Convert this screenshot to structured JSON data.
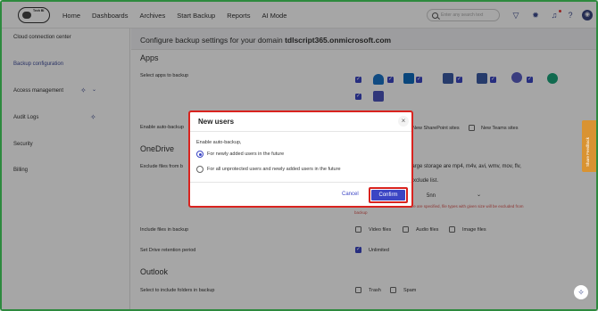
{
  "nav": {
    "brand": "Tech BI",
    "items": [
      "Home",
      "Dashboards",
      "Archives",
      "Start Backup",
      "Reports",
      "AI Mode"
    ],
    "search_placeholder": "Enter any search text"
  },
  "sidebar": {
    "items": [
      "Cloud connection center",
      "Backup configuration",
      "Access management",
      "Audit Logs",
      "Security",
      "Billing"
    ]
  },
  "main": {
    "banner_prefix": "Configure backup settings for your domain ",
    "banner_domain": "tdlscript365.onmicrosoft.com",
    "apps_title": "Apps",
    "select_apps_label": "Select apps to backup",
    "enable_auto_label": "Enable auto-backup",
    "sharepoint_opt": "New SharePoint sites",
    "teams_opt": "New Teams sites",
    "onedrive_title": "OneDrive",
    "exclude_label": "Exclude files from b",
    "exclude_text": "Large storage are mp4, m4v, avi, wmv, mov, flv,",
    "exclude_text2": "xclude list.",
    "size_value": "5nn",
    "size_hint": "ize are specified, file types with given size will be excluded from",
    "size_hint2": "backup",
    "include_files_label": "Include files in backup",
    "include_opts": [
      "Video files",
      "Audio files",
      "Image files"
    ],
    "retention_label": "Set Drive retention period",
    "retention_value": "Unlimited",
    "outlook_title": "Outlook",
    "outlook_label": "Select to include folders in backup",
    "outlook_opts": [
      "Trash",
      "Spam"
    ]
  },
  "modal": {
    "title": "New users",
    "close": "×",
    "subtitle": "Enable auto-backup,",
    "option1": "For newly added users in the future",
    "option2": "For all unprotected users and newly added users in the future",
    "cancel": "Cancel",
    "confirm": "Confirm"
  },
  "feedback": "Share Feedback",
  "colors": {
    "accent": "#3b45c4",
    "highlight": "#d9231f",
    "feedback": "#d99332"
  }
}
